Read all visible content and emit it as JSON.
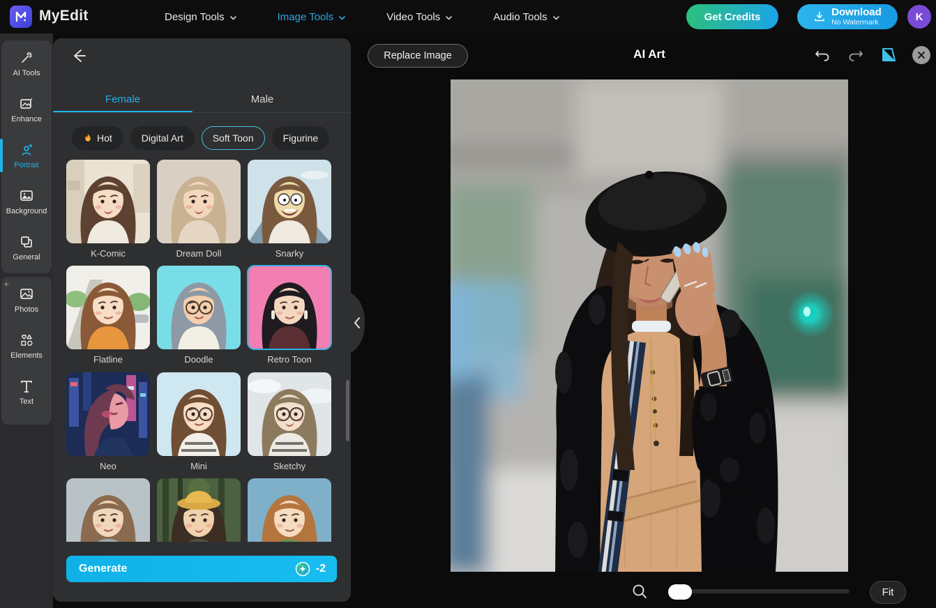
{
  "topbar": {
    "brand": "MyEdit",
    "nav": [
      {
        "label": "Design Tools",
        "active": false
      },
      {
        "label": "Image Tools",
        "active": true
      },
      {
        "label": "Video Tools",
        "active": false
      },
      {
        "label": "Audio Tools",
        "active": false
      }
    ],
    "get_credits_label": "Get Credits",
    "download_label": "Download",
    "download_sublabel": "No Watermark",
    "avatar_initial": "K"
  },
  "rail": {
    "groups": [
      {
        "items": [
          {
            "label": "AI Tools",
            "icon": "magic-wand-icon",
            "active": false
          },
          {
            "label": "Enhance",
            "icon": "image-sparkle-icon",
            "active": false
          },
          {
            "label": "Portrait",
            "icon": "person-sparkle-icon",
            "active": true
          },
          {
            "label": "Background",
            "icon": "image-mountain-icon",
            "active": false
          },
          {
            "label": "General",
            "icon": "layers-icon",
            "active": false
          }
        ]
      },
      {
        "items": [
          {
            "label": "Photos",
            "icon": "photo-icon",
            "active": false
          },
          {
            "label": "Elements",
            "icon": "shapes-icon",
            "active": false
          },
          {
            "label": "Text",
            "icon": "text-icon",
            "active": false
          }
        ]
      }
    ]
  },
  "panel": {
    "tabs": [
      {
        "label": "Female",
        "active": true
      },
      {
        "label": "Male",
        "active": false
      }
    ],
    "filters": [
      {
        "label": "Hot",
        "icon": "fire-icon",
        "selected": false
      },
      {
        "label": "Digital Art",
        "selected": false
      },
      {
        "label": "Soft Toon",
        "selected": true
      },
      {
        "label": "Figurine",
        "selected": false
      }
    ],
    "styles": [
      {
        "label": "K-Comic",
        "selected": false,
        "partial": false,
        "bg": "#eae2d2",
        "hair": "#5d4231",
        "skin": "#f5dcc4",
        "top": "#efe9df",
        "variant": "front",
        "scene": "wall",
        "glasses": false,
        "stripes": false,
        "hat": false,
        "earrings": false,
        "smile": "open"
      },
      {
        "label": "Dream Doll",
        "selected": false,
        "partial": false,
        "bg": "#d9cfc2",
        "hair": "#c9b291",
        "skin": "#f2d7bd",
        "top": "#e5d7c4",
        "variant": "front",
        "scene": "plain",
        "glasses": false,
        "stripes": false,
        "hat": false,
        "earrings": false,
        "smile": "open"
      },
      {
        "label": "Snarky",
        "selected": false,
        "partial": false,
        "bg": "#cfe2e9",
        "hair": "#7a5a3f",
        "skin": "#f0d9a8",
        "top": "#efeadf",
        "variant": "toon",
        "scene": "mountain",
        "glasses": false,
        "stripes": false,
        "hat": false,
        "earrings": false,
        "smile": "open"
      },
      {
        "label": "Flatline",
        "selected": false,
        "partial": false,
        "bg": "#f1efe9",
        "hair": "#8a5a38",
        "skin": "#f7dec4",
        "top": "#e8963e",
        "variant": "front",
        "scene": "street",
        "glasses": false,
        "stripes": false,
        "hat": false,
        "earrings": false,
        "smile": "calm"
      },
      {
        "label": "Doodle",
        "selected": false,
        "partial": false,
        "bg": "#79dde8",
        "hair": "#8e99a6",
        "skin": "#f4cfae",
        "top": "#f2f0e4",
        "variant": "front",
        "scene": "plain",
        "glasses": true,
        "stripes": false,
        "hat": false,
        "earrings": false,
        "smile": "calm"
      },
      {
        "label": "Retro Toon",
        "selected": true,
        "partial": false,
        "bg": "#f27fb1",
        "hair": "#1f1b20",
        "skin": "#f5d7c0",
        "top": "#5a2e33",
        "variant": "front",
        "scene": "plain",
        "glasses": false,
        "stripes": false,
        "hat": false,
        "earrings": true,
        "smile": "calm"
      },
      {
        "label": "Neo",
        "selected": false,
        "partial": false,
        "bg": "#1c2c56",
        "hair": "#6e3a50",
        "skin": "#e89aa5",
        "top": "#22355e",
        "variant": "profile",
        "scene": "city",
        "glasses": false,
        "stripes": false,
        "hat": false,
        "earrings": false,
        "smile": "calm"
      },
      {
        "label": "Mini",
        "selected": false,
        "partial": false,
        "bg": "#cfe7f1",
        "hair": "#6f4e33",
        "skin": "#f7ddc4",
        "top": "#f2efe8",
        "variant": "front",
        "scene": "plain",
        "glasses": true,
        "stripes": true,
        "hat": false,
        "earrings": false,
        "smile": "calm"
      },
      {
        "label": "Sketchy",
        "selected": false,
        "partial": false,
        "bg": "#e0e5e7",
        "hair": "#8c7a5f",
        "skin": "#f2e0cc",
        "top": "#eceae2",
        "variant": "front",
        "scene": "sky",
        "glasses": true,
        "stripes": true,
        "hat": false,
        "earrings": false,
        "smile": "open"
      },
      {
        "label": "",
        "selected": false,
        "partial": true,
        "bg": "#b9c2c6",
        "hair": "#8a6b4f",
        "skin": "#f0d6ba",
        "top": "#9aa8ad",
        "variant": "front",
        "scene": "plain",
        "glasses": false,
        "stripes": false,
        "hat": false,
        "earrings": false,
        "smile": "calm"
      },
      {
        "label": "",
        "selected": false,
        "partial": true,
        "bg": "#4c6140",
        "hair": "#3c2e22",
        "skin": "#f0d2ae",
        "top": "#55503c",
        "variant": "front",
        "scene": "forest",
        "glasses": false,
        "stripes": false,
        "hat": true,
        "earrings": false,
        "smile": "open"
      },
      {
        "label": "",
        "selected": false,
        "partial": true,
        "bg": "#7fb0c9",
        "hair": "#b5753e",
        "skin": "#f6dcc0",
        "top": "#6f8d4e",
        "variant": "front",
        "scene": "plain",
        "glasses": false,
        "stripes": false,
        "hat": false,
        "earrings": false,
        "smile": "calm"
      }
    ],
    "generate_label": "Generate",
    "credit_cost": "-2",
    "accent_color": "#10b4e9"
  },
  "canvas": {
    "replace_image_label": "Replace Image",
    "title": "AI Art",
    "fit_label": "Fit"
  }
}
